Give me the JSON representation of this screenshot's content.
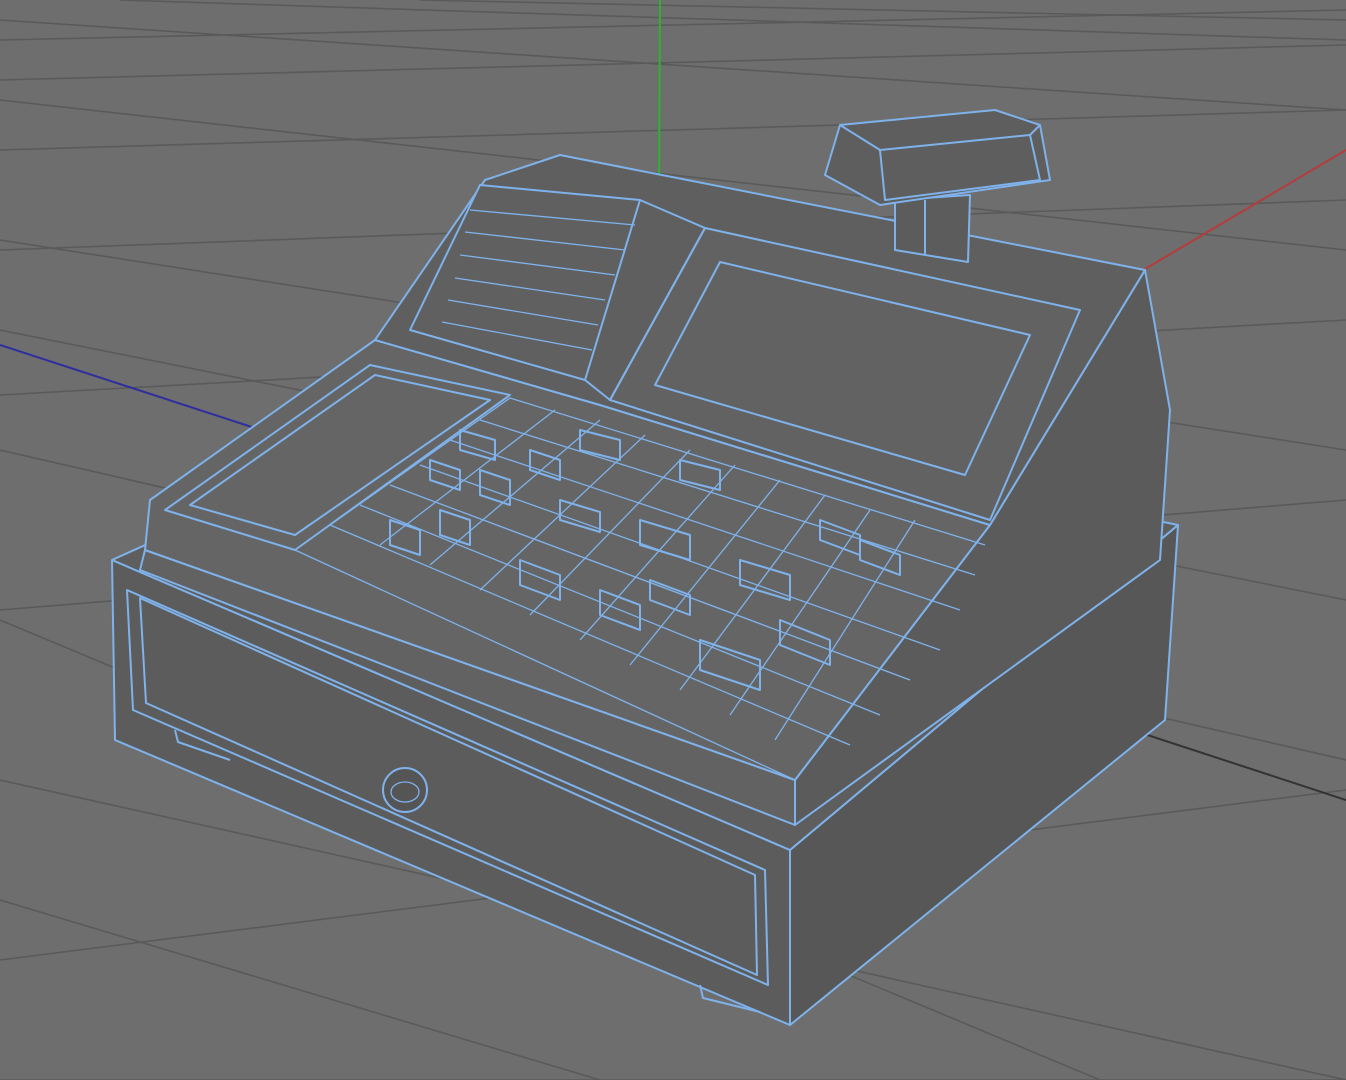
{
  "app": {
    "view": "perspective-viewport"
  },
  "viewport": {
    "background_color": "#6e6e6e",
    "grid_color": "#5a5a5a",
    "axes": [
      {
        "name": "x",
        "color": "#b43c3c"
      },
      {
        "name": "y",
        "color": "#2db32d"
      },
      {
        "name": "z",
        "color": "#2e2e9e"
      }
    ],
    "selection_wire_color": "#7fb2ea",
    "object": {
      "name": "cash-register",
      "selected": true
    }
  }
}
